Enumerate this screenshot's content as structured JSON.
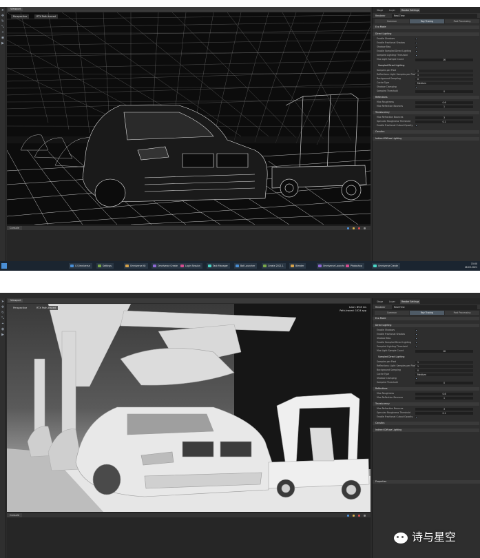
{
  "shot1": {
    "viewport_tab": "Viewport",
    "overlay_mode": "Perspective",
    "overlay_mode2": "RTX Path-traced",
    "console_tab": "Console",
    "panel_tabs": [
      "Stage",
      "Layer",
      "Render Settings"
    ],
    "renderer_label": "Renderer",
    "renderer_value": "Real-Time",
    "sub_tabs": [
      "Common",
      "Ray Tracing",
      "Post Processing"
    ],
    "taskbar": [
      "C:\\Omniverse",
      "Settings",
      "Omniverse Kit",
      "Omniverse Create",
      "Login Session",
      "Task Manager",
      "Bat Launcher",
      "Create 2021.1",
      "Blender",
      "Omniverse Launcher",
      "Photoshop",
      "Omniverse Create"
    ],
    "clock_time": "15:00",
    "clock_date": "26.03.2021"
  },
  "shot2": {
    "viewport_tab": "Viewport",
    "overlay_mode": "Perspective",
    "overlay_mode2": "RTX Path-traced",
    "stats_line1": "Lean: 89.8 ms",
    "stats_line2": "Path-traced: 1024 spp",
    "console_tab": "Console",
    "panel_tabs": [
      "Stage",
      "Layer",
      "Render Settings"
    ],
    "renderer_label": "Renderer",
    "renderer_value": "Real-Time",
    "sub_tabs": [
      "Common",
      "Ray Tracing",
      "Post Processing"
    ],
    "properties_label": "Properties"
  },
  "rt_settings": {
    "sections": [
      {
        "title": "Eco Mode",
        "rows": []
      },
      {
        "title": "Direct Lighting",
        "rows": [
          {
            "label": "Enable Shadows",
            "type": "check"
          },
          {
            "label": "Enable Fractional Shadow",
            "type": "check"
          },
          {
            "label": "Shadow Bias",
            "type": "check"
          },
          {
            "label": "Enable Sampled Direct Lighting",
            "type": "check"
          },
          {
            "label": "Sampled Lighting Threshold",
            "type": "check"
          },
          {
            "label": "Max Light Sample Count",
            "type": "value",
            "value": "16"
          }
        ]
      },
      {
        "title": "Sampled Direct Lighting",
        "rows": [
          {
            "label": "Samples per Pixel",
            "type": "dropdown",
            "value": "1"
          },
          {
            "label": "Reflections: Light Samples per Pixel",
            "type": "dropdown",
            "value": "1"
          },
          {
            "label": "Background Sampling",
            "type": "dropdown",
            "value": "0"
          },
          {
            "label": "Cache Type",
            "type": "dropdown",
            "value": "Medium"
          },
          {
            "label": "Shadow Clamping",
            "type": "check"
          },
          {
            "label": "Sampled Threshold",
            "type": "value",
            "value": "0"
          }
        ]
      },
      {
        "title": "Reflections",
        "rows": [
          {
            "label": "Max Roughness",
            "type": "value",
            "value": "0.6"
          },
          {
            "label": "Max Reflection Bounces",
            "type": "value",
            "value": "1"
          }
        ]
      },
      {
        "title": "Translucency",
        "rows": [
          {
            "label": "Max Refraction Bounces",
            "type": "value",
            "value": "3"
          },
          {
            "label": "Specular Roughness Threshold",
            "type": "value",
            "value": "0.1"
          },
          {
            "label": "Enable Fractional Cutout Opacity",
            "type": "check"
          }
        ]
      },
      {
        "title": "Caustics",
        "rows": []
      },
      {
        "title": "Indirect Diffuse Lighting",
        "rows": []
      }
    ]
  },
  "colors": {
    "panel_bg": "#2e2e2e",
    "viewport_dark": "#0c0c0c",
    "viewport_light": "#9a9a9a",
    "accent": "#4f5b66",
    "taskbar": "#1b2530"
  },
  "watermark": "诗与星空"
}
